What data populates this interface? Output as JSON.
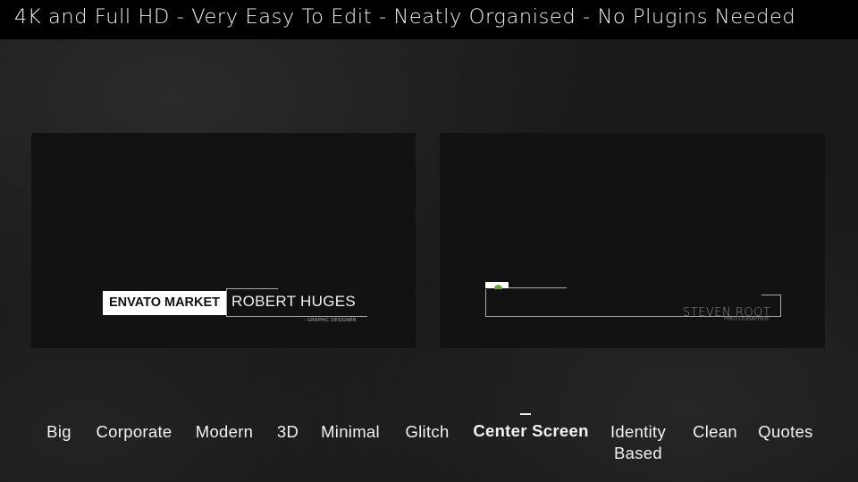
{
  "header": {
    "text": "4K and Full HD - Very Easy To Edit - Neatly Organised - No Plugins Needed"
  },
  "preview_left": {
    "badge": "ENVATO MARKET",
    "name": "ROBERT HUGES",
    "role": "- GRAPHIC DESIGNER"
  },
  "preview_right": {
    "name": "STEVEN ROOT",
    "role": "PHOTOGRAPHER",
    "accent_color": "#6aa33a"
  },
  "categories": {
    "active": "Center Screen",
    "items": [
      "Big",
      "Corporate",
      "Modern",
      "3D",
      "Minimal",
      "Glitch",
      "Center Screen",
      "Identity",
      "Clean",
      "Quotes"
    ],
    "identity_line2": "Based"
  },
  "colors": {
    "header_bg": "#000000",
    "panel_bg": "#121212",
    "text": "#f2f2f2"
  }
}
